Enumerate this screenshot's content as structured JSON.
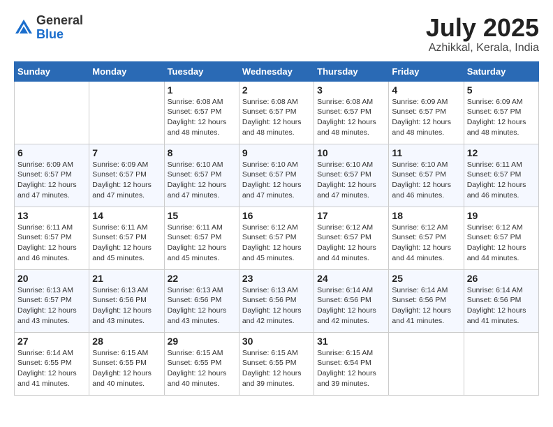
{
  "header": {
    "logo_general": "General",
    "logo_blue": "Blue",
    "month": "July 2025",
    "location": "Azhikkal, Kerala, India"
  },
  "days_of_week": [
    "Sunday",
    "Monday",
    "Tuesday",
    "Wednesday",
    "Thursday",
    "Friday",
    "Saturday"
  ],
  "weeks": [
    [
      {
        "day": "",
        "detail": ""
      },
      {
        "day": "",
        "detail": ""
      },
      {
        "day": "1",
        "detail": "Sunrise: 6:08 AM\nSunset: 6:57 PM\nDaylight: 12 hours and 48 minutes."
      },
      {
        "day": "2",
        "detail": "Sunrise: 6:08 AM\nSunset: 6:57 PM\nDaylight: 12 hours and 48 minutes."
      },
      {
        "day": "3",
        "detail": "Sunrise: 6:08 AM\nSunset: 6:57 PM\nDaylight: 12 hours and 48 minutes."
      },
      {
        "day": "4",
        "detail": "Sunrise: 6:09 AM\nSunset: 6:57 PM\nDaylight: 12 hours and 48 minutes."
      },
      {
        "day": "5",
        "detail": "Sunrise: 6:09 AM\nSunset: 6:57 PM\nDaylight: 12 hours and 48 minutes."
      }
    ],
    [
      {
        "day": "6",
        "detail": "Sunrise: 6:09 AM\nSunset: 6:57 PM\nDaylight: 12 hours and 47 minutes."
      },
      {
        "day": "7",
        "detail": "Sunrise: 6:09 AM\nSunset: 6:57 PM\nDaylight: 12 hours and 47 minutes."
      },
      {
        "day": "8",
        "detail": "Sunrise: 6:10 AM\nSunset: 6:57 PM\nDaylight: 12 hours and 47 minutes."
      },
      {
        "day": "9",
        "detail": "Sunrise: 6:10 AM\nSunset: 6:57 PM\nDaylight: 12 hours and 47 minutes."
      },
      {
        "day": "10",
        "detail": "Sunrise: 6:10 AM\nSunset: 6:57 PM\nDaylight: 12 hours and 47 minutes."
      },
      {
        "day": "11",
        "detail": "Sunrise: 6:10 AM\nSunset: 6:57 PM\nDaylight: 12 hours and 46 minutes."
      },
      {
        "day": "12",
        "detail": "Sunrise: 6:11 AM\nSunset: 6:57 PM\nDaylight: 12 hours and 46 minutes."
      }
    ],
    [
      {
        "day": "13",
        "detail": "Sunrise: 6:11 AM\nSunset: 6:57 PM\nDaylight: 12 hours and 46 minutes."
      },
      {
        "day": "14",
        "detail": "Sunrise: 6:11 AM\nSunset: 6:57 PM\nDaylight: 12 hours and 45 minutes."
      },
      {
        "day": "15",
        "detail": "Sunrise: 6:11 AM\nSunset: 6:57 PM\nDaylight: 12 hours and 45 minutes."
      },
      {
        "day": "16",
        "detail": "Sunrise: 6:12 AM\nSunset: 6:57 PM\nDaylight: 12 hours and 45 minutes."
      },
      {
        "day": "17",
        "detail": "Sunrise: 6:12 AM\nSunset: 6:57 PM\nDaylight: 12 hours and 44 minutes."
      },
      {
        "day": "18",
        "detail": "Sunrise: 6:12 AM\nSunset: 6:57 PM\nDaylight: 12 hours and 44 minutes."
      },
      {
        "day": "19",
        "detail": "Sunrise: 6:12 AM\nSunset: 6:57 PM\nDaylight: 12 hours and 44 minutes."
      }
    ],
    [
      {
        "day": "20",
        "detail": "Sunrise: 6:13 AM\nSunset: 6:57 PM\nDaylight: 12 hours and 43 minutes."
      },
      {
        "day": "21",
        "detail": "Sunrise: 6:13 AM\nSunset: 6:56 PM\nDaylight: 12 hours and 43 minutes."
      },
      {
        "day": "22",
        "detail": "Sunrise: 6:13 AM\nSunset: 6:56 PM\nDaylight: 12 hours and 43 minutes."
      },
      {
        "day": "23",
        "detail": "Sunrise: 6:13 AM\nSunset: 6:56 PM\nDaylight: 12 hours and 42 minutes."
      },
      {
        "day": "24",
        "detail": "Sunrise: 6:14 AM\nSunset: 6:56 PM\nDaylight: 12 hours and 42 minutes."
      },
      {
        "day": "25",
        "detail": "Sunrise: 6:14 AM\nSunset: 6:56 PM\nDaylight: 12 hours and 41 minutes."
      },
      {
        "day": "26",
        "detail": "Sunrise: 6:14 AM\nSunset: 6:56 PM\nDaylight: 12 hours and 41 minutes."
      }
    ],
    [
      {
        "day": "27",
        "detail": "Sunrise: 6:14 AM\nSunset: 6:55 PM\nDaylight: 12 hours and 41 minutes."
      },
      {
        "day": "28",
        "detail": "Sunrise: 6:15 AM\nSunset: 6:55 PM\nDaylight: 12 hours and 40 minutes."
      },
      {
        "day": "29",
        "detail": "Sunrise: 6:15 AM\nSunset: 6:55 PM\nDaylight: 12 hours and 40 minutes."
      },
      {
        "day": "30",
        "detail": "Sunrise: 6:15 AM\nSunset: 6:55 PM\nDaylight: 12 hours and 39 minutes."
      },
      {
        "day": "31",
        "detail": "Sunrise: 6:15 AM\nSunset: 6:54 PM\nDaylight: 12 hours and 39 minutes."
      },
      {
        "day": "",
        "detail": ""
      },
      {
        "day": "",
        "detail": ""
      }
    ]
  ]
}
